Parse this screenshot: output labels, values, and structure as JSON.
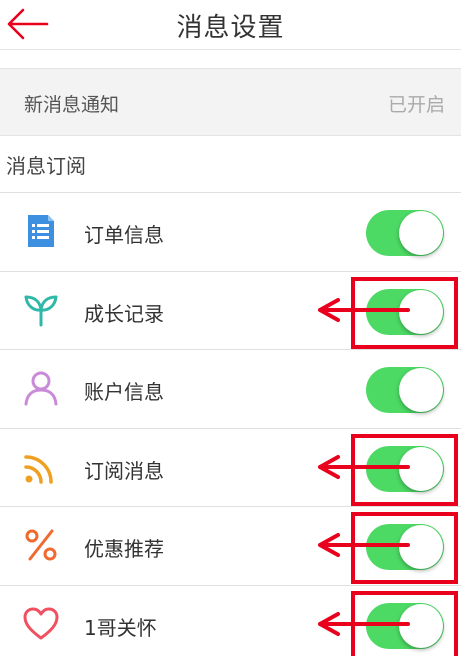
{
  "header": {
    "title": "消息设置",
    "back_icon": "back-arrow-icon",
    "accent_color": "#e8001c"
  },
  "notification": {
    "label": "新消息通知",
    "value": "已开启"
  },
  "subscription": {
    "section_title": "消息订阅",
    "items": [
      {
        "label": "订单信息",
        "icon": "order-list-icon",
        "icon_color": "#3d8fe0",
        "enabled": true,
        "marked": false
      },
      {
        "label": "成长记录",
        "icon": "sprout-icon",
        "icon_color": "#2fb8a8",
        "enabled": true,
        "marked": true
      },
      {
        "label": "账户信息",
        "icon": "user-icon",
        "icon_color": "#c98ad8",
        "enabled": true,
        "marked": false
      },
      {
        "label": "订阅消息",
        "icon": "rss-icon",
        "icon_color": "#f0a020",
        "enabled": true,
        "marked": true
      },
      {
        "label": "优惠推荐",
        "icon": "percent-icon",
        "icon_color": "#f06a30",
        "enabled": true,
        "marked": true
      },
      {
        "label": "1哥关怀",
        "icon": "heart-icon",
        "icon_color": "#f05060",
        "enabled": true,
        "marked": true
      }
    ]
  },
  "colors": {
    "toggle_on": "#4cd964",
    "annotation": "#e8001c"
  }
}
